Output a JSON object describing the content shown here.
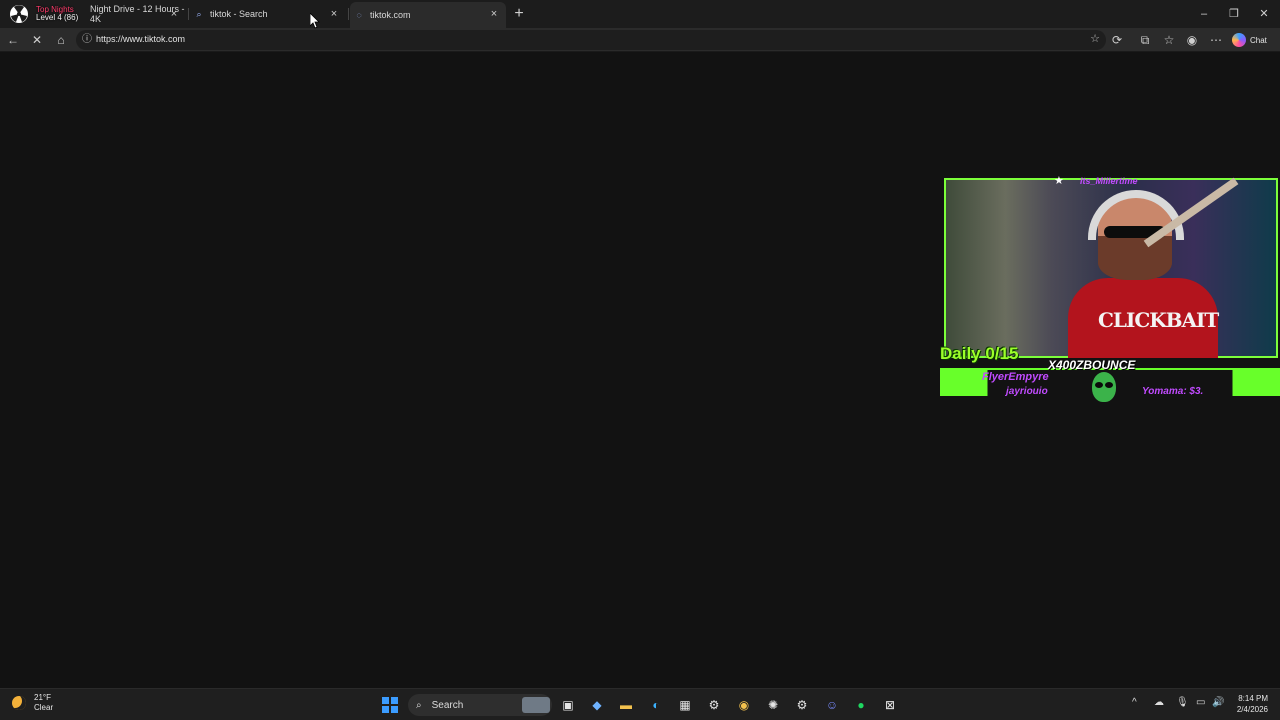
{
  "tabstrip": {
    "stream_overlay_line1": "Top Nights",
    "stream_overlay_line2": "Level 4 (86)",
    "tabs": [
      {
        "label": "Night Drive - 12 Hours - 4K",
        "active": false
      },
      {
        "label": "tiktok - Search",
        "active": false
      },
      {
        "label": "tiktok.com",
        "active": true
      }
    ],
    "new_tab_symbol": "+"
  },
  "toolbar": {
    "url": "https://www.tiktok.com",
    "chat_label": "Chat"
  },
  "overlay": {
    "top_name": "Its_Millertime",
    "hoodie_text": "CLICKBAIT",
    "daily_goal": "Daily 0/15",
    "brand": "X400ZBOUNCE",
    "sub1": "FlyerEmpyre",
    "sub2": "jayriouio",
    "tip": "Yomama: $3."
  },
  "taskbar": {
    "weather_temp": "21°F",
    "weather_cond": "Clear",
    "search_label": "Search",
    "time": "8:14 PM",
    "date": "2/4/2026"
  },
  "colors": {
    "accent_green": "#68ff2a",
    "accent_purple": "#c14bff",
    "windows_blue": "#3b9cff"
  }
}
